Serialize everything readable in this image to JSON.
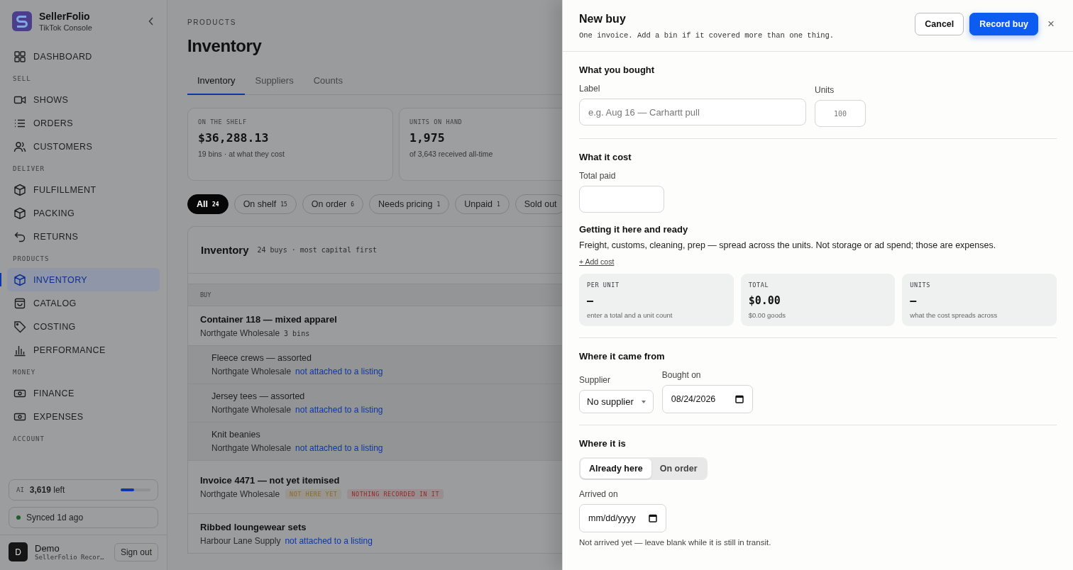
{
  "sidebar": {
    "brand": {
      "name": "SellerFolio",
      "subtitle": "TikTok Console"
    },
    "sections": [
      {
        "items": [
          {
            "label": "DASHBOARD",
            "kind": "grid",
            "selected": false
          }
        ]
      },
      {
        "heading": "SELL",
        "items": [
          {
            "label": "SHOWS",
            "kind": "video",
            "selected": false
          },
          {
            "label": "ORDERS",
            "kind": "list",
            "selected": false
          },
          {
            "label": "CUSTOMERS",
            "kind": "users",
            "selected": false
          }
        ]
      },
      {
        "heading": "DELIVER",
        "items": [
          {
            "label": "FULFILLMENT",
            "kind": "cube",
            "selected": false
          },
          {
            "label": "PACKING",
            "kind": "cube",
            "selected": false
          },
          {
            "label": "RETURNS",
            "kind": "undo",
            "selected": false
          }
        ]
      },
      {
        "heading": "PRODUCTS",
        "items": [
          {
            "label": "INVENTORY",
            "kind": "cube",
            "selected": true
          },
          {
            "label": "CATALOG",
            "kind": "bag",
            "selected": false
          },
          {
            "label": "COSTING",
            "kind": "tag",
            "selected": false
          },
          {
            "label": "PERFORMANCE",
            "kind": "bars",
            "selected": false
          }
        ]
      },
      {
        "heading": "MONEY",
        "items": [
          {
            "label": "FINANCE",
            "kind": "cash",
            "selected": false
          },
          {
            "label": "EXPENSES",
            "kind": "cash",
            "selected": false
          }
        ]
      },
      {
        "heading": "ACCOUNT"
      }
    ],
    "ai": {
      "label": "AI",
      "value": "3,619",
      "suffix": "left",
      "level": 0.45
    },
    "sync": {
      "text": "Synced 1d ago",
      "color": "#1f5c2e"
    },
    "user": {
      "initial": "D",
      "name": "Demo",
      "subtitle": "SellerFolio Recor…"
    },
    "sign_out": "Sign out"
  },
  "main": {
    "eyebrow": "PRODUCTS",
    "title": "Inventory",
    "tabs": [
      {
        "label": "Inventory",
        "selected": true
      },
      {
        "label": "Suppliers",
        "selected": false
      },
      {
        "label": "Counts",
        "selected": false
      }
    ],
    "stats": [
      {
        "label": "ON THE SHELF",
        "value": "$36,288.13",
        "note": "19 bins · at what they cost"
      },
      {
        "label": "UNITS ON HAND",
        "value": "1,975",
        "note": "of 3,643 received all-time"
      }
    ],
    "filters": [
      {
        "label": "All",
        "count": "24",
        "selected": true
      },
      {
        "label": "On shelf",
        "count": "15",
        "selected": false
      },
      {
        "label": "On order",
        "count": "6",
        "selected": false
      },
      {
        "label": "Needs pricing",
        "count": "1",
        "selected": false
      },
      {
        "label": "Unpaid",
        "count": "1",
        "selected": false
      },
      {
        "label": "Sold out",
        "selected": false
      }
    ],
    "table": {
      "title": "Inventory",
      "meta": "24 buys · most capital first",
      "column": "BUY",
      "rows": [
        {
          "title": "Container 118 — mixed apparel",
          "supplier": "Northgate Wholesale",
          "meta": "3 bins",
          "children": [
            {
              "title": "Fleece crews — assorted",
              "supplier": "Northgate Wholesale",
              "link": "not attached to a listing"
            },
            {
              "title": "Jersey tees — assorted",
              "supplier": "Northgate Wholesale",
              "link": "not attached to a listing"
            },
            {
              "title": "Knit beanies",
              "supplier": "Northgate Wholesale",
              "link": "not attached to a listing"
            }
          ]
        },
        {
          "title": "Invoice 4471 — not yet itemised",
          "supplier": "Northgate Wholesale",
          "tags": [
            {
              "text": "NOT HERE YET",
              "color": "#8a6a2a"
            },
            {
              "text": "NOTHING RECORDED IN IT",
              "color": "#8e2a2a"
            }
          ]
        },
        {
          "title": "Ribbed loungewear sets",
          "supplier": "Harbour Lane Supply",
          "link": "not attached to a listing"
        }
      ]
    }
  },
  "drawer": {
    "title": "New buy",
    "subtitle": "One invoice. Add a bin if it covered more than one thing.",
    "cancel": "Cancel",
    "submit": "Record buy",
    "close": "×",
    "bought": {
      "heading": "What you bought",
      "label_field": {
        "label": "Label",
        "placeholder": "e.g. Aug 16 — Carhartt pull"
      },
      "units_field": {
        "label": "Units",
        "placeholder": "100"
      }
    },
    "cost": {
      "heading": "What it cost",
      "total_label": "Total paid",
      "sub_heading": "Getting it here and ready",
      "description": "Freight, customs, cleaning, prep — spread across the units. Not storage or ad spend; those are expenses.",
      "add_link": "+ Add cost",
      "summary": [
        {
          "label": "PER UNIT",
          "value": "–",
          "note": "enter a total and a unit count"
        },
        {
          "label": "TOTAL",
          "value": "$0.00",
          "note": "$0.00 goods"
        },
        {
          "label": "UNITS",
          "value": "–",
          "note": "what the cost spreads across"
        }
      ]
    },
    "source": {
      "heading": "Where it came from",
      "supplier_label": "Supplier",
      "supplier_value": "No supplier",
      "date_label": "Bought on",
      "date_value": "08/24/2026"
    },
    "where": {
      "heading": "Where it is",
      "options": [
        {
          "label": "Already here",
          "selected": true
        },
        {
          "label": "On order",
          "selected": false
        }
      ],
      "arrived_label": "Arrived on",
      "arrived_placeholder": "mm/dd/yyyy",
      "hint": "Not arrived yet — leave blank while it is still in transit."
    }
  }
}
